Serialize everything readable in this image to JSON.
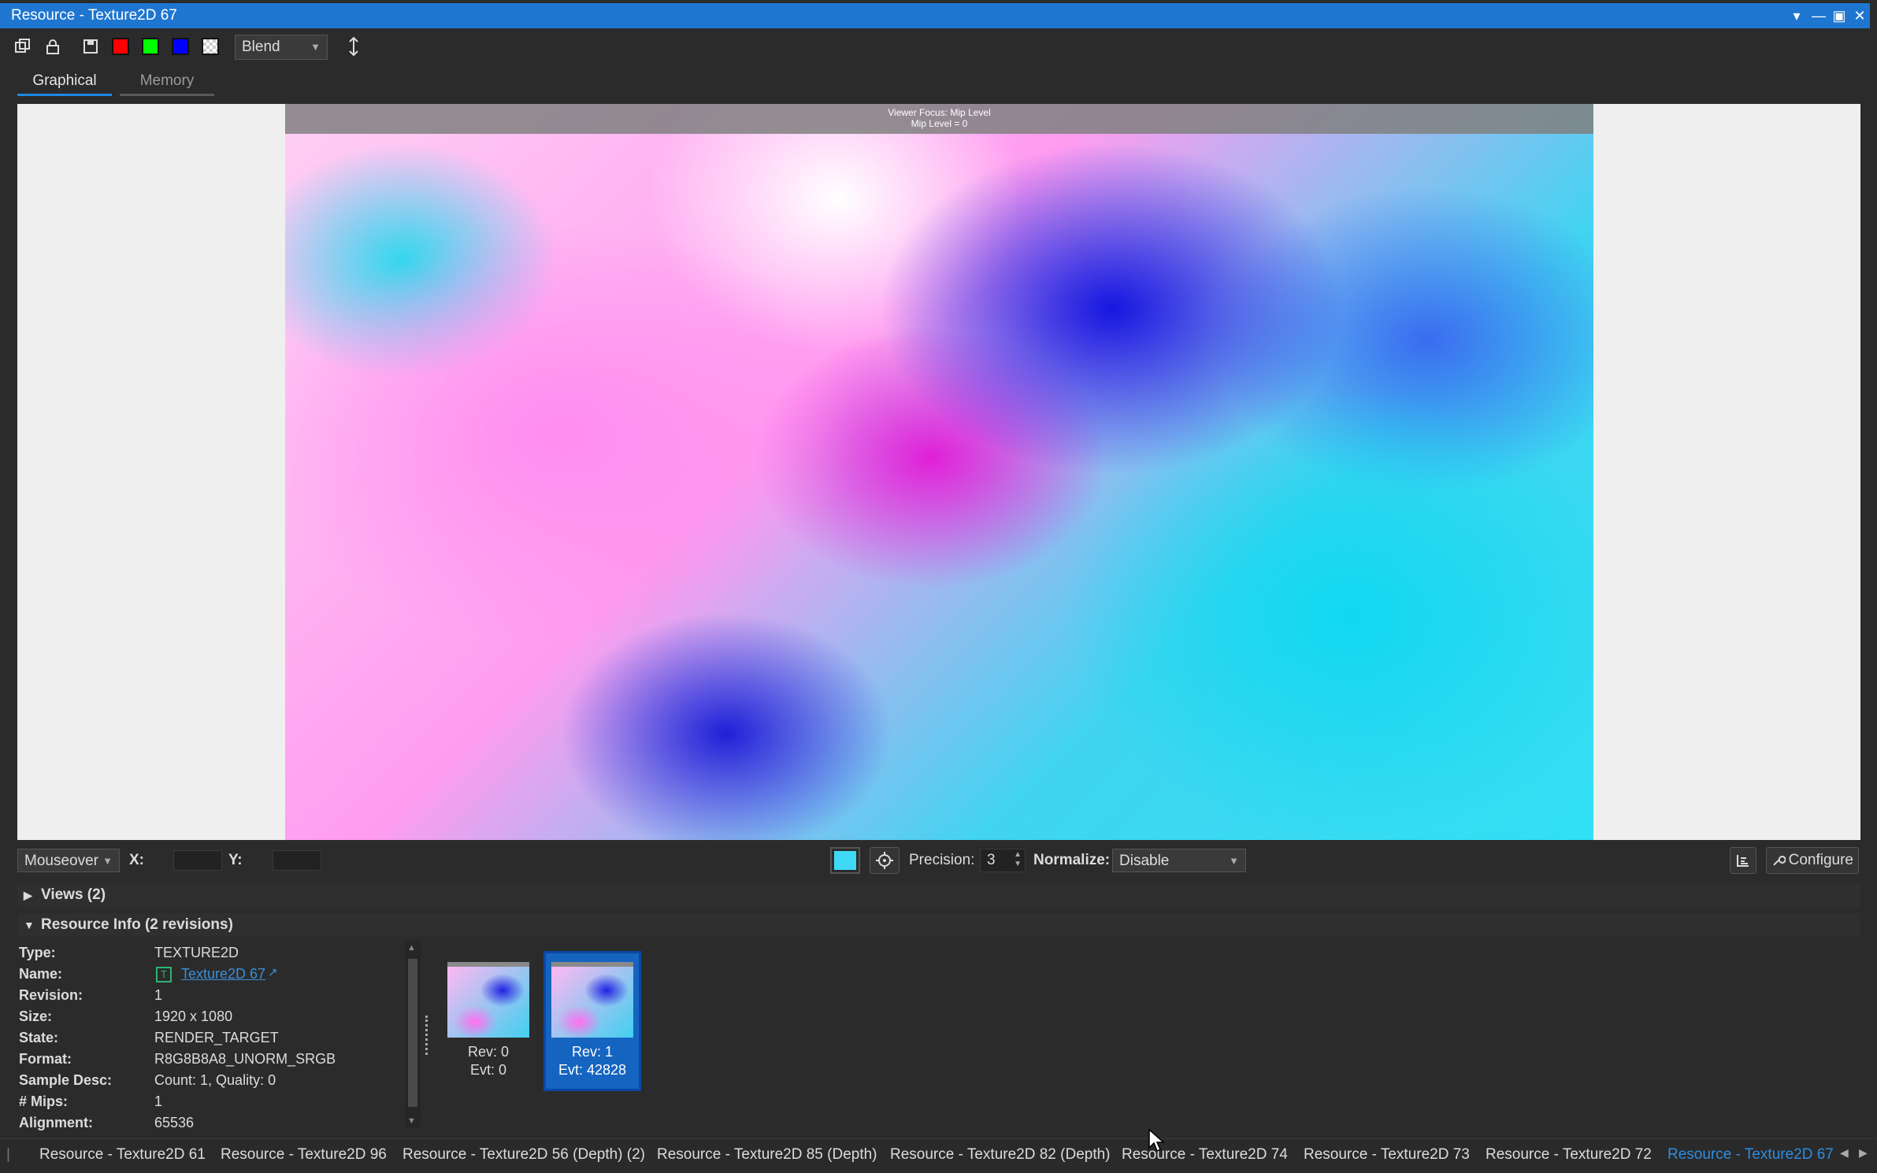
{
  "window": {
    "title": "Resource - Texture2D 67"
  },
  "toolbar": {
    "buttons": [
      "copy-icon",
      "lock-icon",
      "save-icon",
      "red-channel",
      "green-channel",
      "blue-channel",
      "alpha-channel",
      "flip-vertical-icon"
    ],
    "blend_mode": "Blend",
    "colors": {
      "red": "#ff0000",
      "green": "#00ff00",
      "blue": "#0000ff"
    }
  },
  "tabs": [
    "Graphical",
    "Memory"
  ],
  "viewer": {
    "focus_line1": "Viewer Focus: Mip Level",
    "focus_line2": "Mip Level = 0"
  },
  "status": {
    "mode": "Mouseover",
    "x_label": "X:",
    "y_label": "Y:",
    "swatch_color": "#3fd9f5",
    "precision_label": "Precision:",
    "precision_value": "3",
    "normalize_label": "Normalize:",
    "normalize_value": "Disable",
    "configure_label": "Configure"
  },
  "sections": {
    "views": "Views (2)",
    "resource_info": "Resource Info (2 revisions)"
  },
  "resource_info": {
    "rows": [
      {
        "key": "Type:",
        "value": "TEXTURE2D"
      },
      {
        "key": "Name:",
        "value": "Texture2D 67"
      },
      {
        "key": "Revision:",
        "value": "1"
      },
      {
        "key": "Size:",
        "value": "1920 x 1080"
      },
      {
        "key": "State:",
        "value": "RENDER_TARGET"
      },
      {
        "key": "Format:",
        "value": "R8G8B8A8_UNORM_SRGB"
      },
      {
        "key": "Sample Desc:",
        "value": "Count: 1, Quality: 0"
      },
      {
        "key": "# Mips:",
        "value": "1"
      },
      {
        "key": "Alignment:",
        "value": "65536"
      }
    ],
    "name_badge": "T"
  },
  "revisions": [
    {
      "rev": "Rev: 0",
      "evt": "Evt: 0",
      "selected": false
    },
    {
      "rev": "Rev: 1",
      "evt": "Evt: 42828",
      "selected": true
    }
  ],
  "bottom_tabs": [
    "Resource - Texture2D 61",
    "Resource - Texture2D 96",
    "Resource - Texture2D 56 (Depth) (2)",
    "Resource - Texture2D 85 (Depth)",
    "Resource - Texture2D 82 (Depth)",
    "Resource - Texture2D 74",
    "Resource - Texture2D 73",
    "Resource - Texture2D 72",
    "Resource - Texture2D 67"
  ]
}
